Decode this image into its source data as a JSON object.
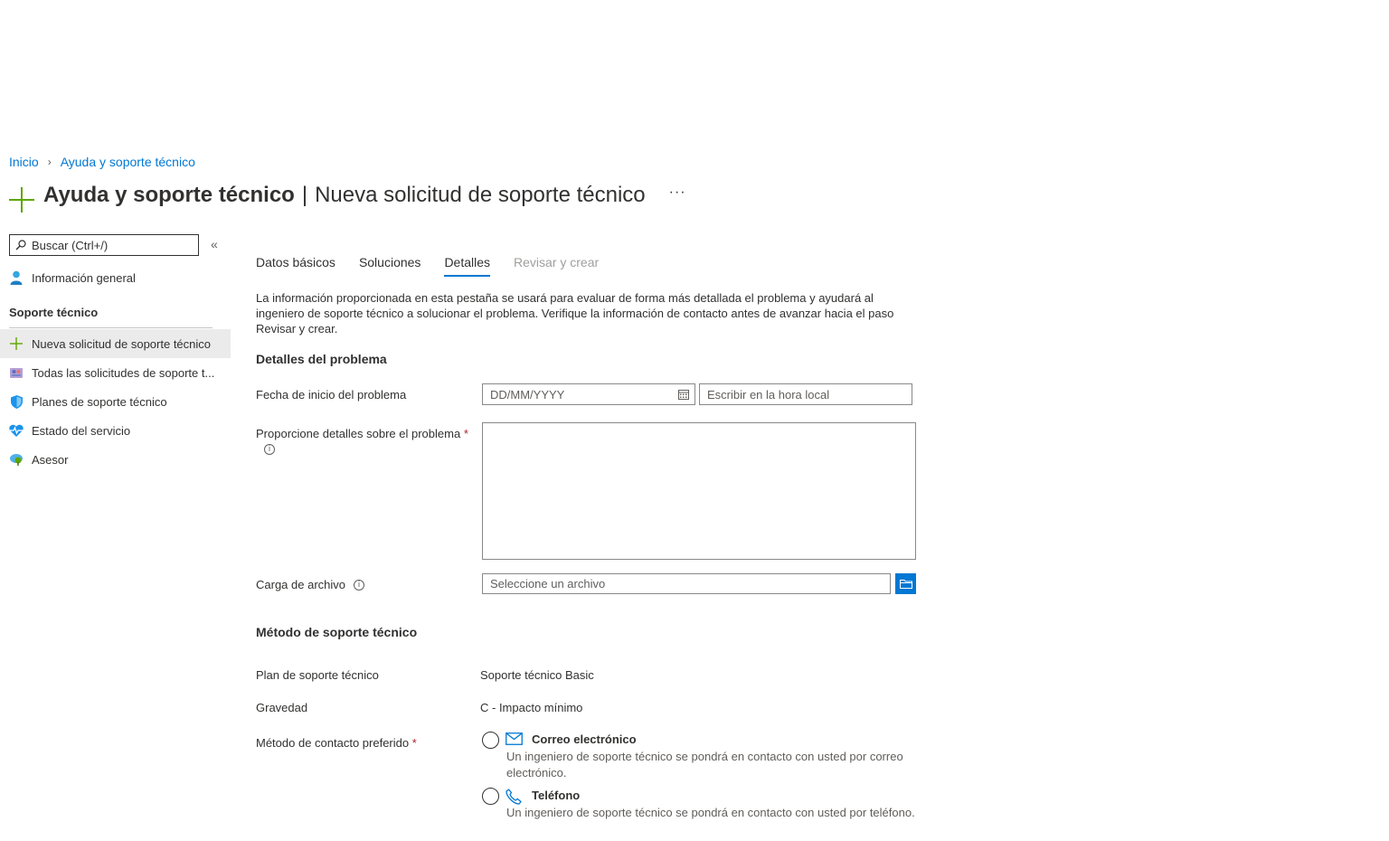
{
  "breadcrumb": [
    {
      "label": "Inicio"
    },
    {
      "label": "Ayuda y soporte técnico"
    }
  ],
  "header": {
    "title": "Ayuda y soporte técnico",
    "separator": "|",
    "subtitle": "Nueva solicitud de soporte técnico",
    "more": "···"
  },
  "sidebar": {
    "search_placeholder": "Buscar (Ctrl+/)",
    "collapse": "«",
    "overview": "Información general",
    "section": "Soporte técnico",
    "items": [
      {
        "label": "Nueva solicitud de soporte técnico",
        "icon": "plus-icon"
      },
      {
        "label": "Todas las solicitudes de soporte t...",
        "icon": "requests-icon"
      },
      {
        "label": "Planes de soporte técnico",
        "icon": "shield-icon"
      },
      {
        "label": "Estado del servicio",
        "icon": "heart-pulse-icon"
      },
      {
        "label": "Asesor",
        "icon": "advisor-icon"
      }
    ]
  },
  "tabs": [
    {
      "label": "Datos básicos",
      "state": "normal"
    },
    {
      "label": "Soluciones",
      "state": "normal"
    },
    {
      "label": "Detalles",
      "state": "active"
    },
    {
      "label": "Revisar y crear",
      "state": "disabled"
    }
  ],
  "intro": "La información proporcionada en esta pestaña se usará para evaluar de forma más detallada el problema y ayudará al ingeniero de soporte técnico a solucionar el problema. Verifique la información de contacto antes de avanzar hacia el paso Revisar y crear.",
  "problem": {
    "section_title": "Detalles del problema",
    "start_date_label": "Fecha de inicio del problema",
    "date_placeholder": "DD/MM/YYYY",
    "time_placeholder": "Escribir en la hora local",
    "details_label": "Proporcione detalles sobre el problema",
    "required_mark": "*",
    "upload_label": "Carga de archivo",
    "upload_placeholder": "Seleccione un archivo"
  },
  "support": {
    "section_title": "Método de soporte técnico",
    "plan_label": "Plan de soporte técnico",
    "plan_value": "Soporte técnico Basic",
    "severity_label": "Gravedad",
    "severity_value": "C - Impacto mínimo",
    "contact_label": "Método de contacto preferido",
    "required_mark": "*",
    "options": [
      {
        "title": "Correo electrónico",
        "desc": "Un ingeniero de soporte técnico se pondrá en contacto con usted por correo electrónico.",
        "icon": "mail-icon"
      },
      {
        "title": "Teléfono",
        "desc": "Un ingeniero de soporte técnico se pondrá en contacto con usted por teléfono.",
        "icon": "phone-icon"
      }
    ]
  },
  "colors": {
    "accent": "#0078d4",
    "green": "#5ea600",
    "required": "#a4262c"
  }
}
